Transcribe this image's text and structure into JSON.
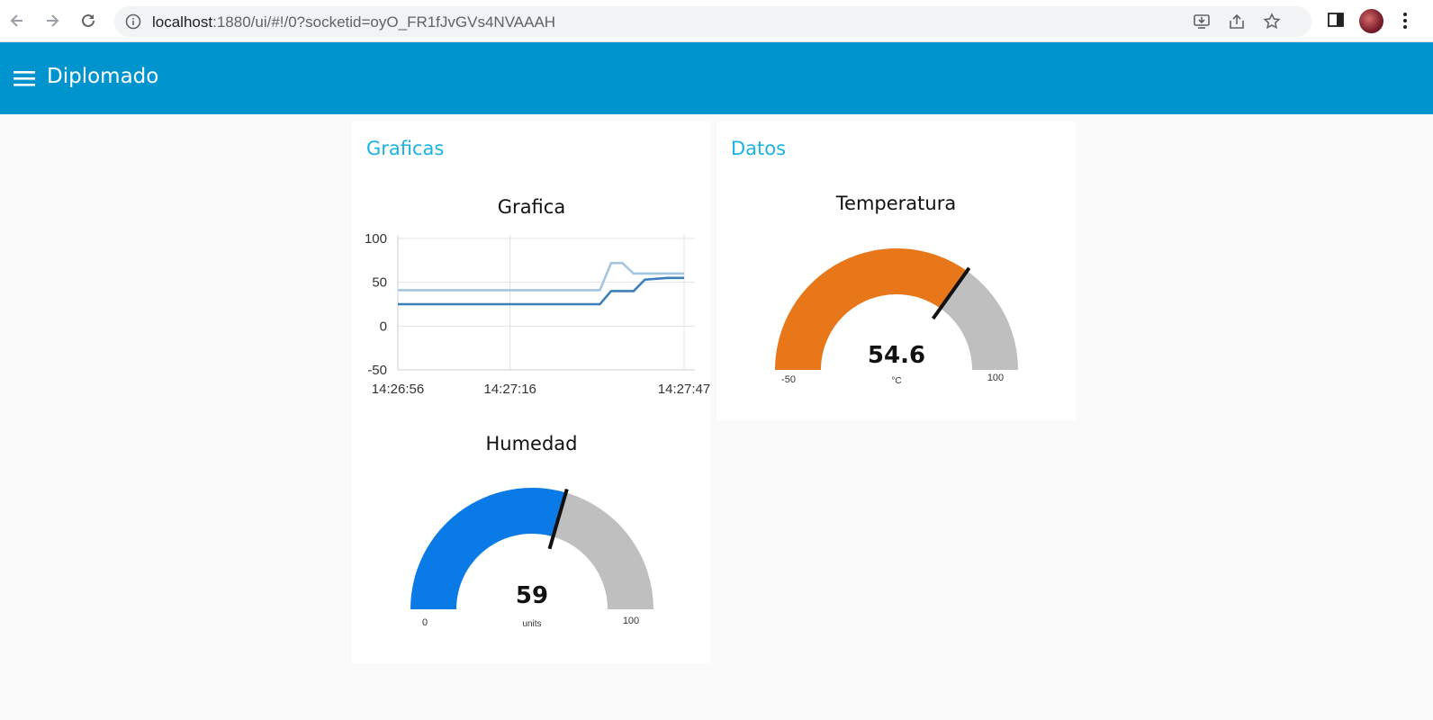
{
  "browser": {
    "url_host": "localhost",
    "url_rest": ":1880/ui/#!/0?socketid=oyO_FR1fJvGVs4NVAAAH"
  },
  "app": {
    "title": "Diplomado"
  },
  "groups": {
    "graficas": {
      "title": "Graficas"
    },
    "datos": {
      "title": "Datos"
    }
  },
  "chart_data": {
    "type": "line",
    "title": "Grafica",
    "x": [
      "14:26:56",
      "14:27:04",
      "14:27:12",
      "14:27:16",
      "14:27:20",
      "14:27:28",
      "14:27:32",
      "14:27:34",
      "14:27:36",
      "14:27:38",
      "14:27:40",
      "14:27:44",
      "14:27:47"
    ],
    "xticks": [
      "14:26:56",
      "14:27:16",
      "14:27:47"
    ],
    "ylim": [
      -50,
      100
    ],
    "yticks": [
      "100",
      "50",
      "0",
      "-50"
    ],
    "grid": true,
    "series": [
      {
        "color": "#a6c6e0",
        "values": [
          41,
          41,
          41,
          41,
          41,
          41,
          41,
          72,
          72,
          60,
          60,
          60,
          60
        ]
      },
      {
        "color": "#3d7fb8",
        "values": [
          25,
          25,
          25,
          25,
          25,
          25,
          25,
          40,
          40,
          40,
          53,
          55,
          55
        ]
      }
    ]
  },
  "gauges": {
    "humedad": {
      "title": "Humedad",
      "value": "59",
      "unit": "units",
      "min": "0",
      "max": "100",
      "fraction": 0.59,
      "color": "#0a7be6"
    },
    "temperatura": {
      "title": "Temperatura",
      "value": "54.6",
      "unit": "°C",
      "min": "-50",
      "max": "100",
      "fraction": 0.697,
      "color": "#e87719"
    }
  }
}
